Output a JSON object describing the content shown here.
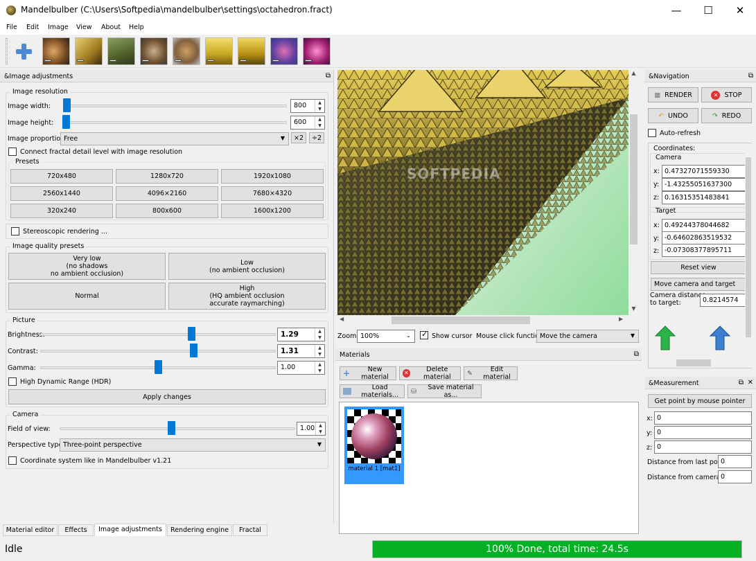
{
  "window": {
    "title": "Mandelbulber (C:\\Users\\Softpedia\\mandelbulber\\settings\\octahedron.fract)",
    "minimize": "—",
    "maximize": "☐",
    "close": "✕"
  },
  "menu": [
    "File",
    "Edit",
    "Image",
    "View",
    "About",
    "Help"
  ],
  "toolbar": {
    "add_icon": "plus-icon",
    "presets": 10,
    "minus": "−"
  },
  "image_adjustments": {
    "title": "&Image adjustments",
    "resolution_group": "Image resolution",
    "width_label": "Image width:",
    "width_value": "800",
    "height_label": "Image height:",
    "height_value": "600",
    "proportion_label": "Image proportion:",
    "proportion_value": "Free",
    "x2": "×2",
    "div2": "÷2",
    "connect_label": "Connect fractal detail level with image resolution",
    "presets_label": "Presets",
    "presets": [
      "720x480",
      "1280x720",
      "1920x1080",
      "2560x1440",
      "4096×2160",
      "7680×4320",
      "320x240",
      "800x600",
      "1600x1200"
    ],
    "stereo_label": "Stereoscopic rendering ...",
    "quality_group": "Image quality presets",
    "quality": {
      "very_low": [
        "Very low",
        "(no shadows",
        "no ambient occlusion)"
      ],
      "low": [
        "Low",
        "(no ambient occlusion)"
      ],
      "normal": "Normal",
      "high": [
        "High",
        "(HQ ambient occlusion",
        "accurate raymarching)"
      ]
    },
    "picture_group": "Picture",
    "brightness_label": "Brightness:",
    "brightness_value": "1.29",
    "contrast_label": "Contrast:",
    "contrast_value": "1.31",
    "gamma_label": "Gamma:",
    "gamma_value": "1.00",
    "hdr_label": "High Dynamic Range (HDR)",
    "apply": "Apply changes",
    "camera_group": "Camera",
    "fov_label": "Field of view:",
    "fov_value": "1.00",
    "perspective_label": "Perspective type:",
    "perspective_value": "Three-point perspective",
    "coord_label": "Coordinate system like in Mandelbulber v1.21"
  },
  "tabs": [
    "Material editor",
    "Effects",
    "Image adjustments",
    "Rendering engine",
    "Fractal"
  ],
  "viewport": {
    "zoom_label": "Zoom:",
    "zoom_value": "100%",
    "show_cursor": "Show cursor",
    "mouse_label": "Mouse click function:",
    "mouse_value": "Move the camera",
    "watermark": "SOFTPEDIA"
  },
  "materials": {
    "title": "Materials",
    "new": "New material",
    "delete": "Delete material",
    "edit": "Edit material",
    "load": "Load materials...",
    "save": "Save material as...",
    "item": "material 1 [mat1]"
  },
  "navigation": {
    "title": "&Navigation",
    "render": "RENDER",
    "stop": "STOP",
    "undo": "UNDO",
    "redo": "REDO",
    "autorefresh": "Auto-refresh",
    "coordinates": "Coordinates:",
    "camera": "Camera",
    "cx": "0.47327071559330",
    "cy": "-1.43255051637300",
    "cz": "0.16315351483841",
    "target": "Target",
    "tx": "0.49244378044682",
    "ty": "-0.64602863519532",
    "tz": "-0.07308377895711",
    "reset": "Reset view",
    "move_camera": "Move camera and target",
    "distance_label": "Camera distance\nto target:",
    "distance_value": "0.8214574",
    "x": "x:",
    "y": "y:",
    "z": "z:"
  },
  "measurement": {
    "title": "&Measurement",
    "get_point": "Get point by mouse pointer",
    "x": "0",
    "y": "0",
    "z": "0",
    "last_label": "Distance from last point:",
    "last_value": "0",
    "camera_label": "Distance from camera:",
    "camera_value": "0"
  },
  "status": {
    "left": "Idle",
    "progress_text": "100% Done, total time: 24.5s",
    "progress": 1.0,
    "progress_color": "#06b025"
  }
}
